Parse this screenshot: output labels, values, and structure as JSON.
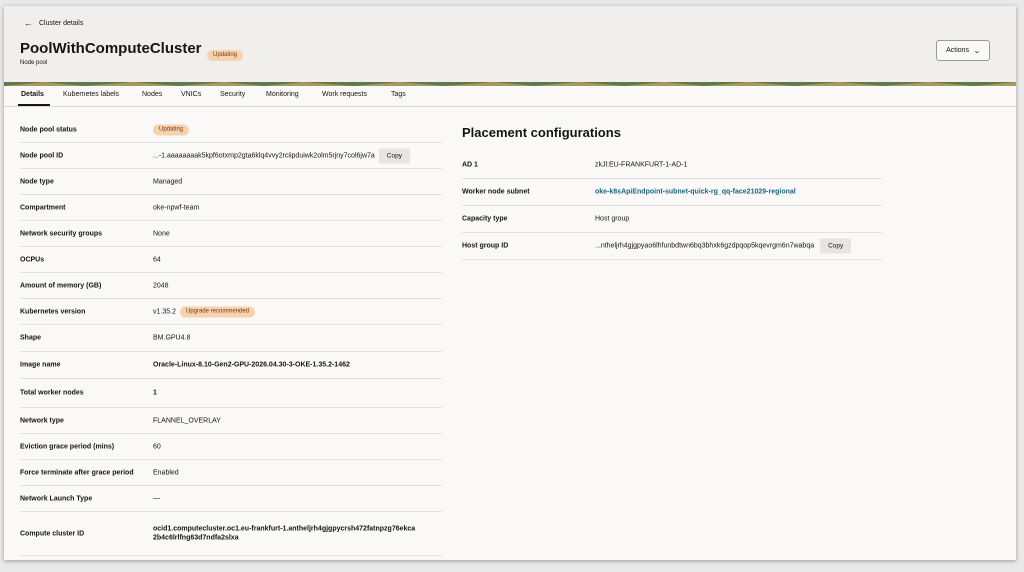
{
  "header": {
    "back_label": "Cluster details",
    "title": "PoolWithComputeCluster",
    "status_badge": "Updating",
    "subtitle": "Node pool",
    "actions_label": "Actions"
  },
  "tabs": [
    {
      "label": "Details"
    },
    {
      "label": "Kubernetes labels"
    },
    {
      "label": "Nodes"
    },
    {
      "label": "VNICs"
    },
    {
      "label": "Security"
    },
    {
      "label": "Monitoring"
    },
    {
      "label": "Work requests"
    },
    {
      "label": "Tags"
    }
  ],
  "details": {
    "node_pool_status": {
      "label": "Node pool status",
      "value": "Updating"
    },
    "node_pool_id": {
      "label": "Node pool ID",
      "value": "...-1.aaaaaaaak5kpf6otxmp2gta6klq4vvy2rciipduiwk2olm5rjny7col6jw7a",
      "copy": "Copy"
    },
    "node_type": {
      "label": "Node type",
      "value": "Managed"
    },
    "compartment": {
      "label": "Compartment",
      "value": "oke-npwf-team"
    },
    "nsg": {
      "label": "Network security groups",
      "value": "None"
    },
    "ocpus": {
      "label": "OCPUs",
      "value": "64"
    },
    "memory": {
      "label": "Amount of memory (GB)",
      "value": "2048"
    },
    "k8s_version": {
      "label": "Kubernetes version",
      "value": "v1.35.2",
      "badge": "Upgrade recommended"
    },
    "shape": {
      "label": "Shape",
      "value": "BM.GPU4.8"
    },
    "image_name": {
      "label": "Image name",
      "value": "Oracle-Linux-8.10-Gen2-GPU-2026.04.30-3-OKE-1.35.2-1462"
    },
    "total_worker_nodes": {
      "label": "Total worker nodes",
      "value": "1"
    },
    "network_type": {
      "label": "Network type",
      "value": "FLANNEL_OVERLAY"
    },
    "eviction_grace": {
      "label": "Eviction grace period (mins)",
      "value": "60"
    },
    "force_terminate": {
      "label": "Force terminate after grace period",
      "value": "Enabled"
    },
    "network_launch_type": {
      "label": "Network Launch Type",
      "value": "—"
    },
    "compute_cluster_id": {
      "label": "Compute cluster ID",
      "value": "ocid1.computecluster.oc1.eu-frankfurt-1.antheljrh4gjgpycrsh472fatnpzg76ekca2b4c6lrlfng63d7ndfa2slxa"
    }
  },
  "placement": {
    "title": "Placement configurations",
    "ad": {
      "label": "AD 1",
      "value": "zkJl:EU-FRANKFURT-1-AD-1"
    },
    "worker_subnet": {
      "label": "Worker node subnet",
      "value": "oke-k8sApiEndpoint-subnet-quick-rg_qq-face21029-regional"
    },
    "capacity_type": {
      "label": "Capacity type",
      "value": "Host group"
    },
    "host_group_id": {
      "label": "Host group ID",
      "value": "...ntheljrh4gjgpyao6lhfunbdtwn6bq3bhxk6gzdpqop5kqevrgm6n7wabqa",
      "copy": "Copy"
    }
  },
  "colors": {
    "badge_bg": "#f6d3ae",
    "link": "#1a6680",
    "header_bg": "#f1efed"
  }
}
